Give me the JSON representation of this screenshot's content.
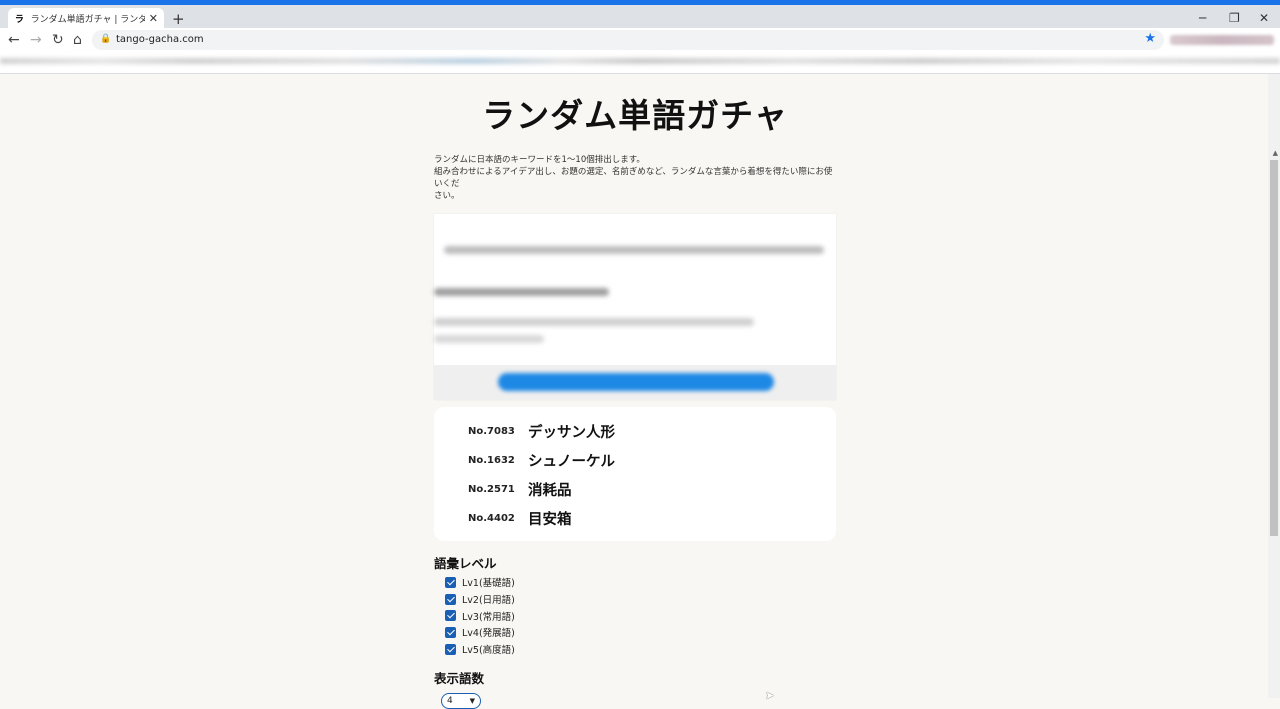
{
  "browser": {
    "tab_title": "ランダム単語ガチャ | ランダムに日本語のキーワードを",
    "favicon_glyph": "ラ",
    "url": "tango-gacha.com",
    "new_tab_glyph": "+",
    "icons": [
      "back-arrow-icon",
      "forward-arrow-icon",
      "reload-icon",
      "home-icon",
      "lock-icon",
      "bookmark-star-icon",
      "minimize-icon",
      "restore-icon",
      "close-icon"
    ]
  },
  "page": {
    "title": "ランダム単語ガチャ",
    "intro_line1": "ランダムに日本語のキーワードを1〜10個排出します。",
    "intro_line2": "組み合わせによるアイデア出し、お題の選定、名前ぎめなど、ランダムな言葉から着想を得たい際にお使いくだ",
    "intro_line3": "さい。"
  },
  "results": [
    {
      "no": "No.7083",
      "word": "デッサン人形"
    },
    {
      "no": "No.1632",
      "word": "シュノーケル"
    },
    {
      "no": "No.2571",
      "word": "消耗品"
    },
    {
      "no": "No.4402",
      "word": "目安箱"
    }
  ],
  "levels": {
    "heading": "語彙レベル",
    "items": [
      {
        "label": "Lv1(基礎語)",
        "checked": true
      },
      {
        "label": "Lv2(日用語)",
        "checked": true
      },
      {
        "label": "Lv3(常用語)",
        "checked": true
      },
      {
        "label": "Lv4(発展語)",
        "checked": true
      },
      {
        "label": "Lv5(高度語)",
        "checked": true
      }
    ]
  },
  "count": {
    "heading": "表示語数",
    "selected": "4"
  },
  "colors": {
    "accent": "#1a73e8",
    "checkbox": "#1a5fb4",
    "page_bg": "#f8f7f3"
  }
}
